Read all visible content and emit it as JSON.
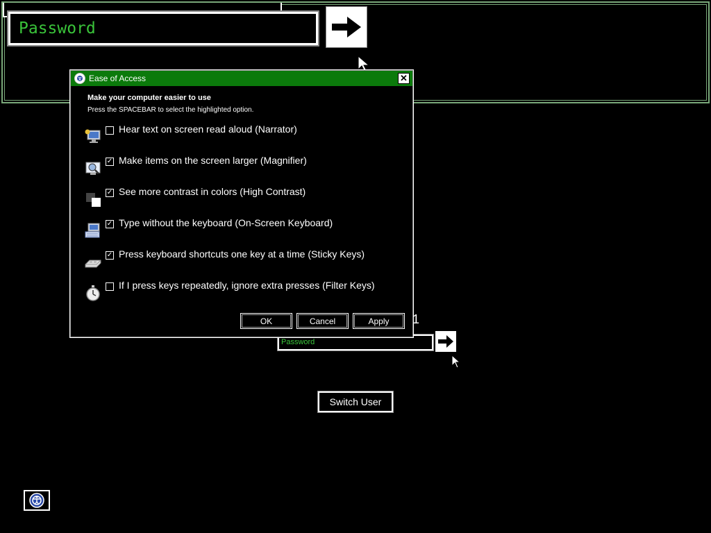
{
  "magnifier": {
    "password_placeholder": "Password",
    "submit_icon": "right-arrow-icon"
  },
  "dialog": {
    "title": "Ease of Access",
    "heading": "Make your computer easier to use",
    "subheading": "Press the SPACEBAR to select the highlighted option.",
    "options": [
      {
        "label": "Hear text on screen read aloud (Narrator)",
        "checked": false,
        "icon": "narrator-icon"
      },
      {
        "label": "Make items on the screen larger (Magnifier)",
        "checked": true,
        "icon": "magnifier-icon"
      },
      {
        "label": "See more contrast in colors (High Contrast)",
        "checked": true,
        "icon": "high-contrast-icon"
      },
      {
        "label": "Type without the keyboard (On-Screen Keyboard)",
        "checked": true,
        "icon": "on-screen-keyboard-icon"
      },
      {
        "label": "Press keyboard shortcuts one key at a time (Sticky Keys)",
        "checked": true,
        "icon": "sticky-keys-icon"
      },
      {
        "label": "If I press keys repeatedly, ignore extra presses (Filter Keys)",
        "checked": false,
        "icon": "filter-keys-icon"
      }
    ],
    "buttons": {
      "ok": "OK",
      "cancel": "Cancel",
      "apply": "Apply"
    }
  },
  "login": {
    "user_partial": "1",
    "password_placeholder": "Password",
    "switch_user": "Switch User"
  },
  "colors": {
    "title_bar": "#0b7a0b",
    "password_text": "#3ac43a",
    "magnifier_border": "#7aa87a"
  }
}
